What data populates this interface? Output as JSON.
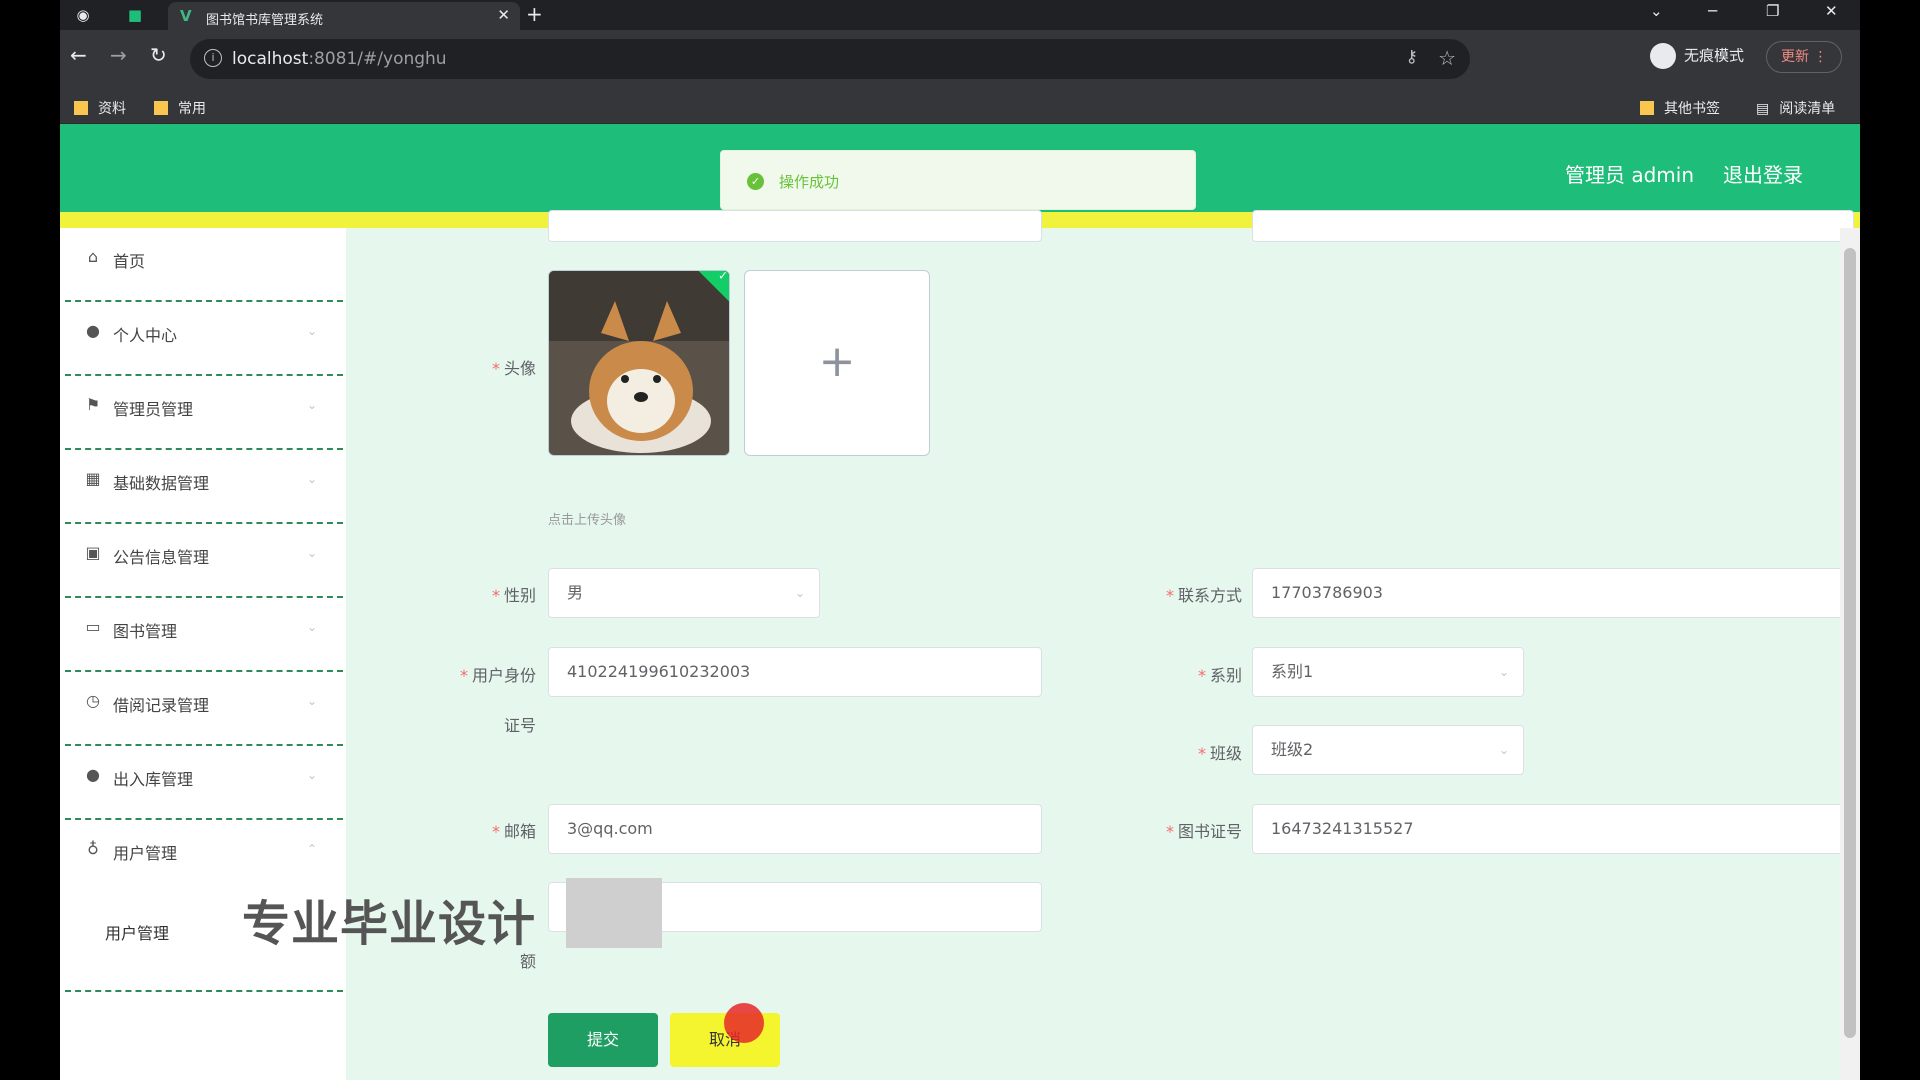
{
  "browser": {
    "tab_title": "图书馆书库管理系统",
    "url_host": "localhost",
    "url_rest": ":8081/#/yonghu",
    "incognito_label": "无痕模式",
    "update_label": "更新",
    "bookmarks": [
      "资料",
      "常用"
    ],
    "bookmarks_right": [
      "其他书签",
      "阅读清单"
    ]
  },
  "header": {
    "admin_label": "管理员 admin",
    "logout_label": "退出登录"
  },
  "toast": {
    "message": "操作成功"
  },
  "sidebar": {
    "items": [
      {
        "label": "首页",
        "icon": "home-icon"
      },
      {
        "label": "个人中心",
        "icon": "user-icon"
      },
      {
        "label": "管理员管理",
        "icon": "flag-icon"
      },
      {
        "label": "基础数据管理",
        "icon": "grid-icon"
      },
      {
        "label": "公告信息管理",
        "icon": "clipboard-icon"
      },
      {
        "label": "图书管理",
        "icon": "book-icon"
      },
      {
        "label": "借阅记录管理",
        "icon": "clock-icon"
      },
      {
        "label": "出入库管理",
        "icon": "user-icon"
      },
      {
        "label": "用户管理",
        "icon": "mic-icon"
      }
    ],
    "submenu_label": "用户管理"
  },
  "form": {
    "avatar_label": "头像",
    "upload_hint": "点击上传头像",
    "gender_label": "性别",
    "gender_value": "男",
    "contact_label": "联系方式",
    "contact_value": "17703786903",
    "id_label_line1": "用户身份",
    "id_label_line2": "证号",
    "id_value": "410224199610232003",
    "department_label": "系别",
    "department_value": "系别1",
    "class_label": "班级",
    "class_value": "班级2",
    "email_label": "邮箱",
    "email_value": "3@qq.com",
    "library_card_label": "图书证号",
    "library_card_value": "16473241315527",
    "extra_label": "额",
    "submit_label": "提交",
    "cancel_label": "取消"
  },
  "watermark": "专业毕业设计"
}
